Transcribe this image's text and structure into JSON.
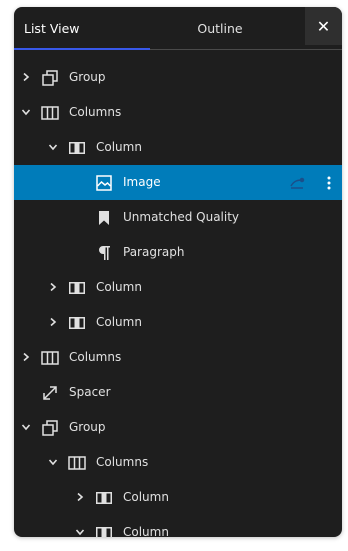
{
  "tabs": {
    "list_view": "List View",
    "outline": "Outline",
    "close_glyph": "✕"
  },
  "colors": {
    "panel_bg": "#1e1e1e",
    "selected_row": "#007cba",
    "tab_accent": "#3858e9",
    "text": "#e0e0e0"
  },
  "tree": {
    "rows": [
      {
        "label": "Group",
        "icon": "group-icon",
        "chevron": "right",
        "level": 0
      },
      {
        "label": "Columns",
        "icon": "columns-icon",
        "chevron": "down",
        "level": 0
      },
      {
        "label": "Column",
        "icon": "column-icon",
        "chevron": "down",
        "level": 1
      },
      {
        "label": "Image",
        "icon": "image-icon",
        "chevron": "none",
        "level": 2,
        "selected": true
      },
      {
        "label": "Unmatched Quality",
        "icon": "bookmark-icon",
        "chevron": "none",
        "level": 2
      },
      {
        "label": "Paragraph",
        "icon": "paragraph-icon",
        "chevron": "none",
        "level": 2
      },
      {
        "label": "Column",
        "icon": "column-icon",
        "chevron": "right",
        "level": 1
      },
      {
        "label": "Column",
        "icon": "column-icon",
        "chevron": "right",
        "level": 1
      },
      {
        "label": "Columns",
        "icon": "columns-icon",
        "chevron": "right",
        "level": 0
      },
      {
        "label": "Spacer",
        "icon": "spacer-icon",
        "chevron": "none",
        "level": 0
      },
      {
        "label": "Group",
        "icon": "group-icon",
        "chevron": "down",
        "level": 0
      },
      {
        "label": "Columns",
        "icon": "columns-icon",
        "chevron": "down",
        "level": 1
      },
      {
        "label": "Column",
        "icon": "column-icon",
        "chevron": "right",
        "level": 2
      },
      {
        "label": "Column",
        "icon": "column-icon",
        "chevron": "down",
        "level": 2
      }
    ]
  }
}
